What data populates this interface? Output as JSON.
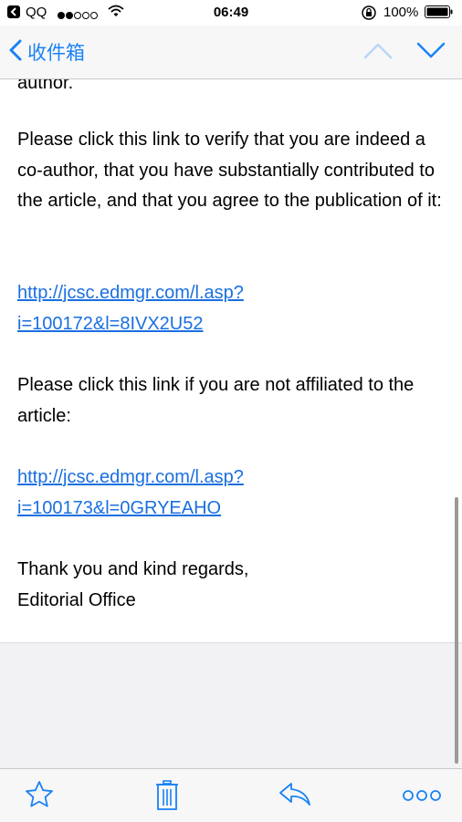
{
  "status_bar": {
    "carrier": "QQ",
    "time": "06:49",
    "battery_percent": "100%"
  },
  "nav": {
    "back_label": "收件箱"
  },
  "email": {
    "clipped_text": "author.",
    "para1": "Please click this link to verify that you are indeed a co-author, that you have substantially contributed to the article, and that you agree to the publication of it:",
    "link1_line1": "http://jcsc.edmgr.com/l.asp?",
    "link1_line2": "i=100172&l=8IVX2U52",
    "para2": "Please click this link if you are not affiliated to the article:",
    "link2_line1": "http://jcsc.edmgr.com/l.asp?",
    "link2_line2": "i=100173&l=0GRYEAHO",
    "closing_line1": "Thank you and kind regards,",
    "closing_line2": "Editorial Office"
  },
  "toolbar": {
    "icons": [
      "star-icon",
      "trash-icon",
      "reply-icon",
      "more-icon"
    ]
  },
  "colors": {
    "accent": "#1a82f4",
    "link": "#1a6fe0"
  }
}
